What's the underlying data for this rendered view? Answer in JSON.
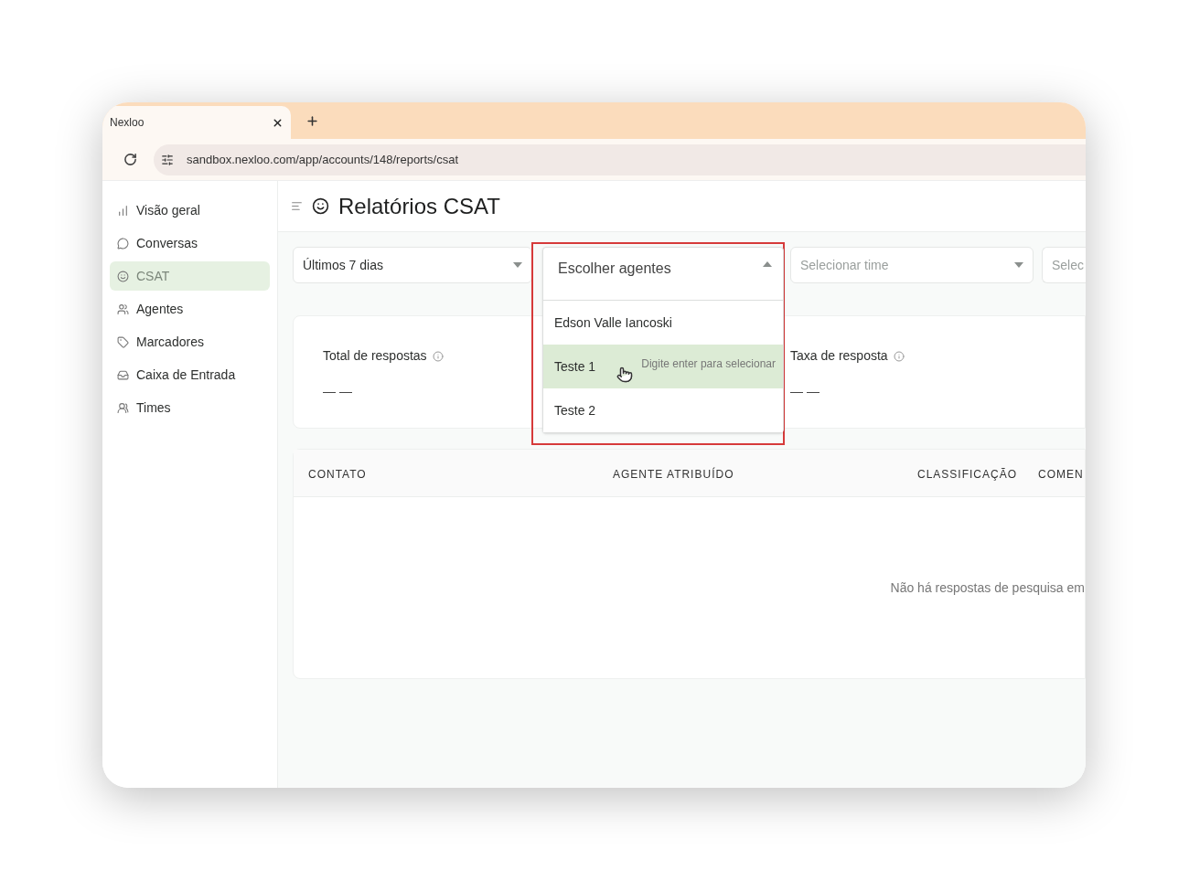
{
  "browser": {
    "tab_title": "Nexloo",
    "url": "sandbox.nexloo.com/app/accounts/148/reports/csat"
  },
  "sidebar": {
    "items": [
      {
        "label": "Visão geral",
        "kind": "overview",
        "selected": false
      },
      {
        "label": "Conversas",
        "kind": "conversations",
        "selected": false
      },
      {
        "label": "CSAT",
        "kind": "csat",
        "selected": true
      },
      {
        "label": "Agentes",
        "kind": "agents",
        "selected": false
      },
      {
        "label": "Marcadores",
        "kind": "labels",
        "selected": false
      },
      {
        "label": "Caixa de Entrada",
        "kind": "inbox",
        "selected": false
      },
      {
        "label": "Times",
        "kind": "teams",
        "selected": false
      }
    ]
  },
  "header": {
    "title": "Relatórios CSAT"
  },
  "filters": [
    {
      "kind": "date",
      "value": "Últimos 7 dias"
    },
    {
      "kind": "agents",
      "placeholder": "Escolher agentes",
      "expanded": true
    },
    {
      "kind": "team",
      "placeholder": "Selecionar time"
    },
    {
      "kind": "partial",
      "placeholder": "Selec"
    }
  ],
  "agent_dropdown": {
    "options": [
      {
        "label": "Edson Valle Iancoski",
        "selected": false
      },
      {
        "label": "Teste 1",
        "selected": true,
        "hint": "Digite enter para selecionar"
      },
      {
        "label": "Teste 2",
        "selected": false
      }
    ]
  },
  "metrics": [
    {
      "label": "Total de respostas",
      "value": "— —"
    },
    {
      "label": "Taxa de resposta",
      "value": "— —"
    }
  ],
  "table": {
    "columns": [
      "CONTATO",
      "AGENTE ATRIBUÍDO",
      "CLASSIFICAÇÃO",
      "COMEN"
    ],
    "empty_message": "Não há respostas de pesquisa em"
  }
}
